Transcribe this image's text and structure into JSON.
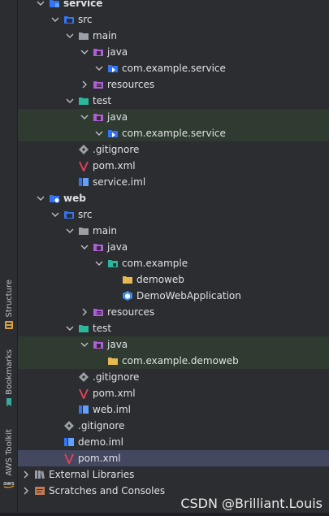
{
  "tree": [
    {
      "label": "service",
      "depth": 1,
      "expanded": true,
      "icon": "module-folder-icon",
      "bold": true
    },
    {
      "label": "src",
      "depth": 2,
      "expanded": true,
      "icon": "source-folder-icon"
    },
    {
      "label": "main",
      "depth": 3,
      "expanded": true,
      "icon": "folder-icon"
    },
    {
      "label": "java",
      "depth": 4,
      "expanded": true,
      "icon": "java-source-root-icon"
    },
    {
      "label": "com.example.service",
      "depth": 5,
      "expanded": true,
      "icon": "package-icon"
    },
    {
      "label": "resources",
      "depth": 4,
      "expanded": false,
      "icon": "resources-root-icon"
    },
    {
      "label": "test",
      "depth": 3,
      "expanded": true,
      "icon": "test-folder-icon"
    },
    {
      "label": "java",
      "depth": 4,
      "expanded": true,
      "icon": "java-source-root-icon",
      "highlight": true
    },
    {
      "label": "com.example.service",
      "depth": 5,
      "expanded": true,
      "icon": "package-icon",
      "highlight": true
    },
    {
      "label": ".gitignore",
      "depth": 3,
      "icon": "gitignore-icon"
    },
    {
      "label": "pom.xml",
      "depth": 3,
      "icon": "maven-icon"
    },
    {
      "label": "service.iml",
      "depth": 3,
      "icon": "iml-icon"
    },
    {
      "label": "web",
      "depth": 1,
      "expanded": true,
      "icon": "web-module-icon",
      "bold": true
    },
    {
      "label": "src",
      "depth": 2,
      "expanded": true,
      "icon": "source-folder-icon"
    },
    {
      "label": "main",
      "depth": 3,
      "expanded": true,
      "icon": "folder-icon"
    },
    {
      "label": "java",
      "depth": 4,
      "expanded": true,
      "icon": "java-source-root-icon"
    },
    {
      "label": "com.example",
      "depth": 5,
      "expanded": true,
      "icon": "package-teal-icon"
    },
    {
      "label": "demoweb",
      "depth": 6,
      "icon": "plain-folder-icon"
    },
    {
      "label": "DemoWebApplication",
      "depth": 6,
      "icon": "spring-class-icon"
    },
    {
      "label": "resources",
      "depth": 4,
      "expanded": false,
      "icon": "resources-root-icon"
    },
    {
      "label": "test",
      "depth": 3,
      "expanded": true,
      "icon": "test-folder-icon"
    },
    {
      "label": "java",
      "depth": 4,
      "expanded": true,
      "icon": "java-source-root-icon",
      "highlight": true
    },
    {
      "label": "com.example.demoweb",
      "depth": 5,
      "icon": "plain-folder-icon",
      "highlight": true
    },
    {
      "label": ".gitignore",
      "depth": 3,
      "icon": "gitignore-icon"
    },
    {
      "label": "pom.xml",
      "depth": 3,
      "icon": "maven-icon"
    },
    {
      "label": "web.iml",
      "depth": 3,
      "icon": "iml-icon"
    },
    {
      "label": ".gitignore",
      "depth": 2,
      "icon": "gitignore-icon"
    },
    {
      "label": "demo.iml",
      "depth": 2,
      "icon": "iml-icon"
    },
    {
      "label": "pom.xml",
      "depth": 2,
      "icon": "maven-icon",
      "selected": true
    },
    {
      "label": "External Libraries",
      "depth": 0,
      "expanded": false,
      "icon": "libraries-icon"
    },
    {
      "label": "Scratches and Consoles",
      "depth": 0,
      "expanded": false,
      "icon": "scratches-icon"
    }
  ],
  "side_tabs": {
    "structure": "Structure",
    "bookmarks": "Bookmarks",
    "aws": "AWS Toolkit"
  },
  "watermark": "CSDN @Brilliant.Louis"
}
